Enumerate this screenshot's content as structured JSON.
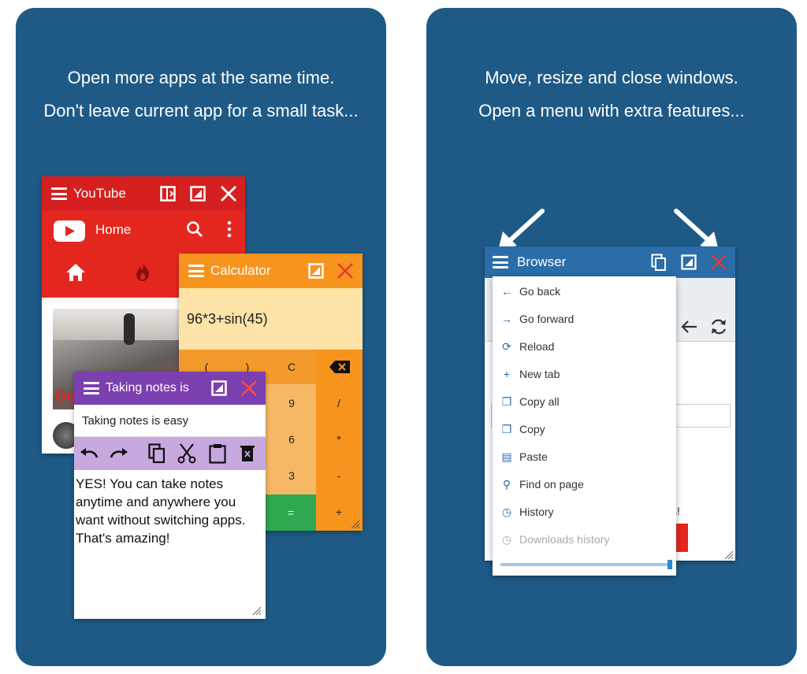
{
  "left_panel": {
    "caption_line1": "Open more apps at the same time.",
    "caption_line2": "Don't leave current app for a small task...",
    "youtube": {
      "title": "YouTube",
      "nav_label": "Home",
      "thumbnail_label": "Ge",
      "color": "#e4271e"
    },
    "calculator": {
      "title": "Calculator",
      "expression": "96*3+sin(45)",
      "keys": [
        "(",
        ")",
        "C",
        "9",
        "/",
        "6",
        "*",
        "3",
        "-",
        "=",
        "+"
      ],
      "color": "#f7941d"
    },
    "notes": {
      "title": "Taking notes is",
      "note_title": "Taking notes is easy",
      "body": "YES! You can take notes anytime and anywhere you want without switching apps. That's amazing!",
      "color": "#7b3fb0"
    }
  },
  "right_panel": {
    "caption_line1": "Move, resize and close windows.",
    "caption_line2": "Open a menu with extra features...",
    "browser": {
      "title": "Browser",
      "color": "#2a6da8",
      "menu_items": [
        {
          "label": "Go back",
          "icon": "arrow-left-icon",
          "glyph": "←"
        },
        {
          "label": "Go forward",
          "icon": "arrow-right-icon",
          "glyph": "→"
        },
        {
          "label": "Reload",
          "icon": "reload-icon",
          "glyph": "⟳"
        },
        {
          "label": "New tab",
          "icon": "plus-icon",
          "glyph": "+"
        },
        {
          "label": "Copy all",
          "icon": "copy-icon",
          "glyph": "❐"
        },
        {
          "label": "Copy",
          "icon": "copy-icon",
          "glyph": "❐"
        },
        {
          "label": "Paste",
          "icon": "clipboard-icon",
          "glyph": "▤"
        },
        {
          "label": "Find on page",
          "icon": "search-icon",
          "glyph": "⚲"
        },
        {
          "label": "History",
          "icon": "history-icon",
          "glyph": "◷"
        },
        {
          "label": "Downloads history",
          "icon": "downloads-history-icon",
          "glyph": "◷"
        }
      ],
      "peek_text": "s!"
    }
  }
}
